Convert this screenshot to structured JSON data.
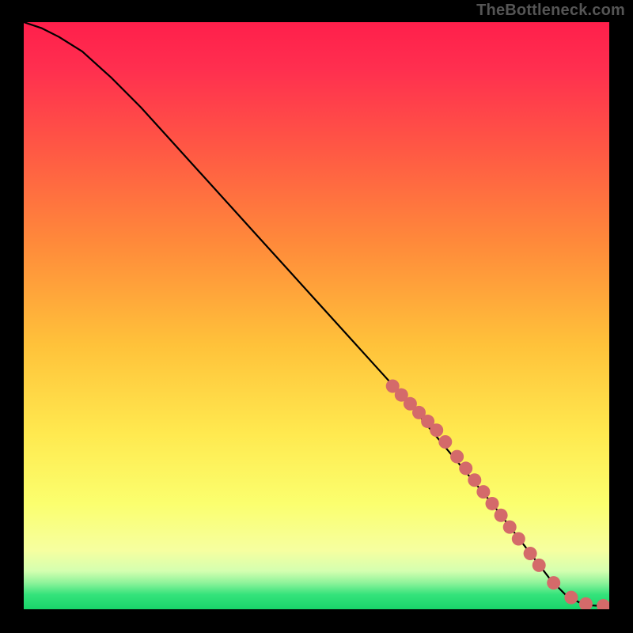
{
  "watermark": "TheBottleneck.com",
  "colors": {
    "frame": "#000000",
    "watermark": "#555555",
    "gradient_top": "#ff2a4f",
    "gradient_mid_upper": "#ff7a3a",
    "gradient_mid": "#ffd23a",
    "gradient_mid_lower": "#fff96b",
    "gradient_band": "#d7ffb0",
    "gradient_green": "#2ee37a",
    "curve": "#000000",
    "marker": "#d46a6a"
  },
  "chart_data": {
    "type": "line",
    "title": "",
    "xlabel": "",
    "ylabel": "",
    "xlim": [
      0,
      100
    ],
    "ylim": [
      0,
      100
    ],
    "series": [
      {
        "name": "bottleneck-curve",
        "x": [
          0,
          3,
          6,
          10,
          15,
          20,
          25,
          30,
          35,
          40,
          45,
          50,
          55,
          60,
          65,
          70,
          75,
          80,
          85,
          90,
          93,
          96,
          100
        ],
        "y": [
          100,
          99,
          97.5,
          95,
          90.5,
          85.5,
          80,
          74.5,
          69,
          63.5,
          58,
          52.5,
          47,
          41.5,
          36,
          30,
          24,
          18,
          11.5,
          5,
          2,
          0.7,
          0.5
        ]
      }
    ],
    "markers": {
      "name": "highlighted-points",
      "x": [
        63,
        64.5,
        66,
        67.5,
        69,
        70.5,
        72,
        74,
        75.5,
        77,
        78.5,
        80,
        81.5,
        83,
        84.5,
        86.5,
        88,
        90.5,
        93.5,
        96,
        99
      ],
      "y": [
        38,
        36.5,
        35,
        33.5,
        32,
        30.5,
        28.5,
        26,
        24,
        22,
        20,
        18,
        16,
        14,
        12,
        9.5,
        7.5,
        4.5,
        2,
        0.9,
        0.6
      ]
    }
  }
}
